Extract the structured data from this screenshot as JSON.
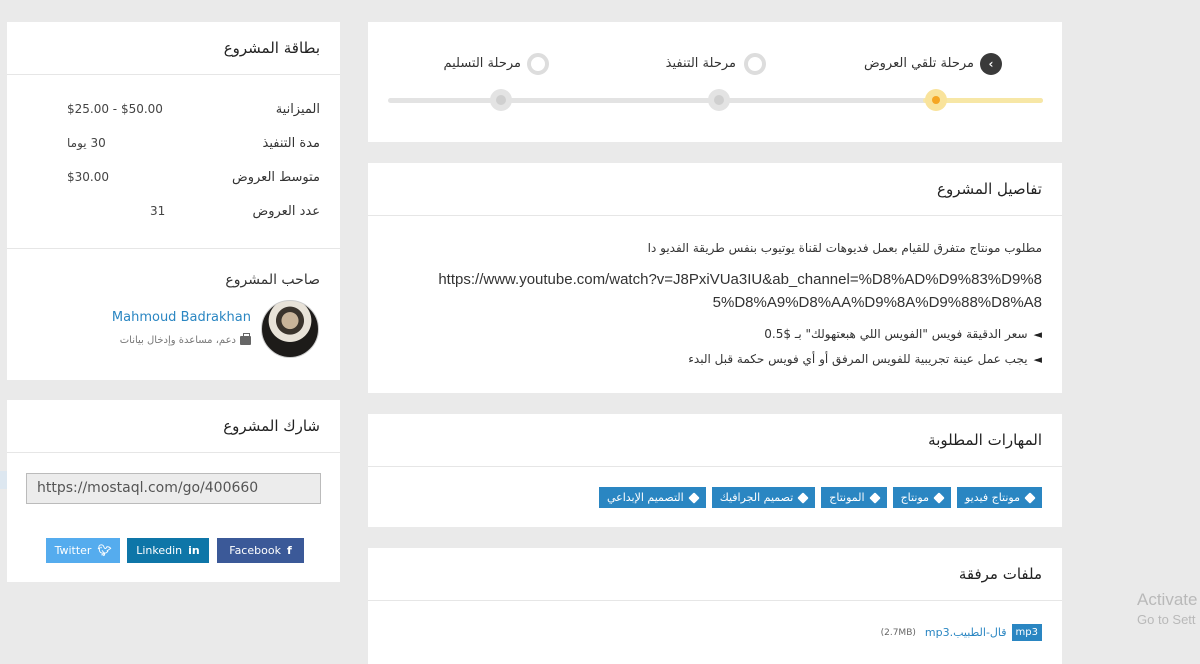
{
  "project_card": {
    "title": "بطاقة المشروع",
    "rows": [
      {
        "key": "الميزانية",
        "value": "$25.00 - $50.00"
      },
      {
        "key": "مدة التنفيذ",
        "value": "30 يوما"
      },
      {
        "key": "متوسط العروض",
        "value": "$30.00"
      },
      {
        "key": "عدد العروض",
        "value": "31"
      }
    ],
    "owner_title": "صاحب المشروع",
    "owner_name": "Mahmoud Badrakhan",
    "owner_role": "دعم، مساعدة وإدخال بيانات"
  },
  "share_card": {
    "title": "شارك المشروع",
    "url": "https://mostaql.com/go/400660",
    "facebook": "Facebook",
    "linkedin": "Linkedin",
    "twitter": "Twitter"
  },
  "stages": {
    "items": [
      {
        "label": "مرحلة تلقي العروض",
        "state": "active"
      },
      {
        "label": "مرحلة التنفيذ",
        "state": "pending"
      },
      {
        "label": "مرحلة التسليم",
        "state": "pending"
      }
    ]
  },
  "details": {
    "title": "تفاصيل المشروع",
    "description": "مطلوب مونتاج متفرق للقيام بعمل فديوهات لقناة يوتيوب بنفس طريقة الفديو دا",
    "url": "https://www.youtube.com/watch?v=J8PxiVUa3IU&ab_channel=%D8%AD%D9%83%D9%85%D8%A9%D8%AA%D9%8A%D9%88%D8%A8",
    "bullets": [
      "سعر الدقيقة فويس \"الفويس اللي هبعتهولك\" بـ $0.5",
      "يجب عمل عينة تجريبية للفويس المرفق أو أي فويس حكمة قبل البدء"
    ]
  },
  "skills": {
    "title": "المهارات المطلوبة",
    "items": [
      "مونتاج فيديو",
      "مونتاج",
      "المونتاج",
      "تصميم الجرافيك",
      "التصميم الإبداعي"
    ]
  },
  "files": {
    "title": "ملفات مرفقة",
    "badge": "mp3",
    "name": "قال-الطبيب.mp3",
    "size": "(2.7MB)"
  },
  "os_overlay": {
    "line1": "Activate",
    "line2": "Go to Sett"
  },
  "colors": {
    "accent": "#2a86c2",
    "progress": "#f5a623",
    "facebook": "#3b5998",
    "linkedin": "#0e76a8",
    "twitter": "#55acee"
  }
}
